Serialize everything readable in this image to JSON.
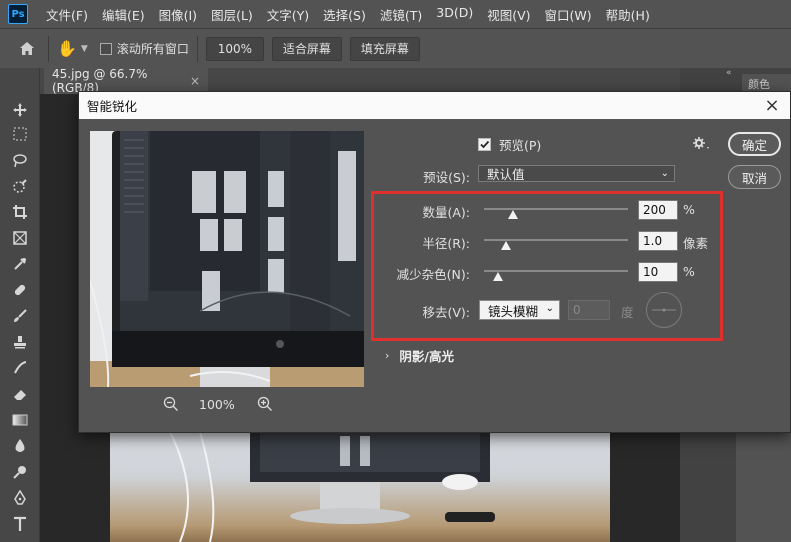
{
  "app": {
    "logo_text": "Ps"
  },
  "menu": [
    "文件(F)",
    "编辑(E)",
    "图像(I)",
    "图层(L)",
    "文字(Y)",
    "选择(S)",
    "滤镜(T)",
    "3D(D)",
    "视图(V)",
    "窗口(W)",
    "帮助(H)"
  ],
  "options": {
    "scroll_all_label": "滚动所有窗口",
    "zoom_value": "100%",
    "fit_screen_label": "适合屏幕",
    "fill_screen_label": "填充屏幕"
  },
  "document_tab": {
    "title": "45.jpg @ 66.7%(RGB/8)",
    "close": "×"
  },
  "right_panel": {
    "tab_label": "颜色"
  },
  "dialog": {
    "title": "智能锐化",
    "close": "×",
    "preview_label": "预览(P)",
    "preview_checked": true,
    "ok_label": "确定",
    "cancel_label": "取消",
    "preset_label": "预设(S):",
    "preset_value": "默认值",
    "amount": {
      "label": "数量(A):",
      "value": "200",
      "unit": "%",
      "fraction": 0.2
    },
    "radius": {
      "label": "半径(R):",
      "value": "1.0",
      "unit": "像素",
      "fraction": 0.15
    },
    "noise": {
      "label": "减少杂色(N):",
      "value": "10",
      "unit": "%",
      "fraction": 0.1
    },
    "remove": {
      "label": "移去(V):",
      "value": "镜头模糊",
      "angle_value": "0",
      "angle_unit": "度"
    },
    "shadows_label": "阴影/高光",
    "zoom_level": "100%"
  },
  "colors": {
    "highlight_box": "#e0302e",
    "accent": "#31a8ff"
  }
}
